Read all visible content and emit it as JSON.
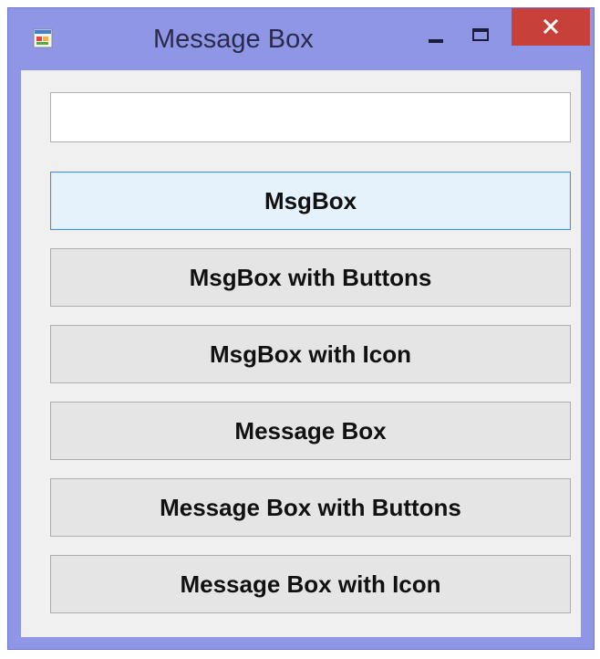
{
  "window": {
    "title": "Message Box",
    "controls": {
      "minimize_icon": "minimize-icon",
      "maximize_icon": "maximize-icon",
      "close_icon": "close-icon"
    },
    "colors": {
      "frame": "#8f96e6",
      "close_button": "#c7403a",
      "client_background": "#f0f0f0",
      "focused_button_border": "#3c8fd8"
    }
  },
  "form": {
    "input_value": "",
    "buttons": [
      {
        "label": "MsgBox",
        "focused": true
      },
      {
        "label": "MsgBox with Buttons"
      },
      {
        "label": "MsgBox with Icon"
      },
      {
        "label": "Message Box"
      },
      {
        "label": "Message Box with Buttons"
      },
      {
        "label": "Message Box with Icon"
      }
    ]
  }
}
